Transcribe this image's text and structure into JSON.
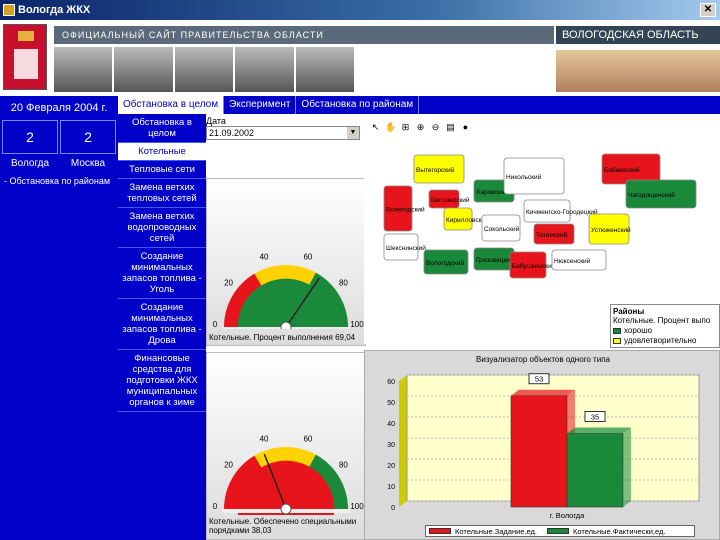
{
  "window": {
    "title": "Вологда ЖКХ"
  },
  "header": {
    "site_strip": "ОФИЦИАЛЬНЫЙ САЙТ ПРАВИТЕЛЬСТВА ОБЛАСТИ",
    "region_title": "ВОЛОГОДСКАЯ ОБЛАСТЬ"
  },
  "left_panel": {
    "date": "20 Февраля 2004 г.",
    "city1_value": "2",
    "city2_value": "2",
    "city1_name": "Вологда",
    "city2_name": "Москва",
    "link": "- Обстановка по районам"
  },
  "tabs": [
    "Обстановка в целом",
    "Эксперимент",
    "Обстановка по районам"
  ],
  "menu": [
    "Обстановка в целом",
    "Котельные",
    "Тепловые сети",
    "Замена ветхих тепловых сетей",
    "Замена ветхих водопроводных сетей",
    "Создание минимальных запасов топлива - Уголь",
    "Создание минимальных запасов топлива - Дрова",
    "Финансовые средства для подготовки ЖКХ муниципальных органов к зиме"
  ],
  "content": {
    "date_label": "Дата",
    "date_value": "21.09.2002",
    "gauge1": {
      "value": 69.04,
      "caption": "Котельные. Процент выполнения",
      "value_text": "69,04"
    },
    "gauge2": {
      "value": 38.03,
      "caption": "Котельные. Обеспечено специальными порядками",
      "value_text": "38,03"
    },
    "gauge_ticks": [
      "0",
      "20",
      "40",
      "60",
      "80",
      "100"
    ]
  },
  "map": {
    "regions": [
      {
        "name": "Вытегорский",
        "color": "yellow"
      },
      {
        "name": "Вожегодский",
        "color": "red"
      },
      {
        "name": "Белозерский",
        "color": "red"
      },
      {
        "name": "Кирилловский",
        "color": "yellow"
      },
      {
        "name": "Харовский",
        "color": "green"
      },
      {
        "name": "Никольский",
        "color": "gray"
      },
      {
        "name": "Кичменгско-Городецкий",
        "color": "gray"
      },
      {
        "name": "Сокольский",
        "color": "gray"
      },
      {
        "name": "Тотемский",
        "color": "red"
      },
      {
        "name": "Бабаевский",
        "color": "red"
      },
      {
        "name": "Чагодощенский",
        "color": "green"
      },
      {
        "name": "Устюженский",
        "color": "yellow"
      },
      {
        "name": "Шекснинский",
        "color": "gray"
      },
      {
        "name": "Вологодский",
        "color": "green"
      },
      {
        "name": "Грязовецкий",
        "color": "green"
      },
      {
        "name": "Бабушкинский",
        "color": "red"
      },
      {
        "name": "Нюксенский",
        "color": "gray"
      }
    ],
    "legend_title": "Районы",
    "legend_subtitle": "Котельные. Процент выпо",
    "legend_items": [
      {
        "label": "хорошо",
        "color": "#1a8a3a"
      },
      {
        "label": "удовлетворительно",
        "color": "#ffff00"
      }
    ],
    "colors": {
      "red": "#e8141c",
      "yellow": "#ffff00",
      "green": "#1a8a3a",
      "gray": "#ffffff"
    }
  },
  "chart_data": {
    "type": "bar",
    "title": "Визуализатор объектов одного типа",
    "categories": [
      "г. Вологда"
    ],
    "series": [
      {
        "name": "Котельные.Задание,ед.",
        "values": [
          53
        ],
        "color": "#e8141c"
      },
      {
        "name": "Котельные.Фактически,ед.",
        "values": [
          35
        ],
        "color": "#1a8a3a"
      }
    ],
    "ylim": [
      0,
      60
    ],
    "yticks": [
      0,
      10,
      20,
      30,
      40,
      50,
      60
    ],
    "grid": true,
    "legend": "bottom"
  }
}
